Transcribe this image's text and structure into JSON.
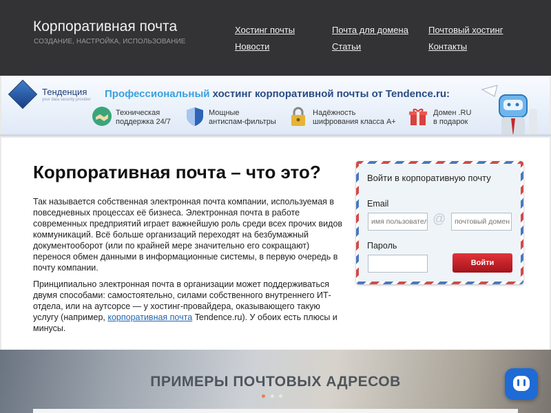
{
  "header": {
    "title": "Корпоративная почта",
    "subtitle": "СОЗДАНИЕ, НАСТРОЙКА, ИСПОЛЬЗОВАНИЕ",
    "nav": [
      "Хостинг почты",
      "Почта для домена",
      "Почтовый хостинг",
      "Новости",
      "Статьи",
      "Контакты"
    ]
  },
  "banner": {
    "logo_name": "Тенденция",
    "logo_tagline": "your data security provider",
    "headline_part1": "Профессиональный",
    "headline_part2": " хостинг корпоративной почты от Tendence.ru:",
    "features": [
      {
        "icon": "handshake-icon",
        "line1": "Техническая",
        "line2": "поддержка 24/7"
      },
      {
        "icon": "shield-icon",
        "line1": "Мощные",
        "line2": "антиспам-фильтры"
      },
      {
        "icon": "padlock-icon",
        "line1": "Надёжность",
        "line2": "шифрования класса A+"
      },
      {
        "icon": "gift-icon",
        "line1": "Домен .RU",
        "line2": "в подарок"
      }
    ]
  },
  "main": {
    "title": "Корпоративная почта – что это?",
    "para1": "Так называется собственная электронная почта компании, используемая в повседневных процессах её бизнеса. Электронная почта в работе современных предприятий играет важнейшую роль среди всех прочих видов коммуникаций. Всё больше организаций переходят на безбумажный документооборот (или по крайней мере значительно его сокращают) перенося обмен данными в информационные системы, в первую очередь в почту компании.",
    "para2_before": "Принципиально электронная почта в организации может поддерживаться двумя способами: самостоятельно, силами собственного внутреннего ИТ-отдела, или на аутсорсе — у хостинг-провайдера, оказывающего такую услугу (например, ",
    "para2_link": "корпоративная почта",
    "para2_after": " Tendence.ru). У обоих есть плюсы и минусы."
  },
  "login": {
    "title": "Войти в корпоративную почту",
    "email_label": "Email",
    "user_placeholder": "имя пользователя",
    "at_symbol": "@",
    "domain_placeholder": "почтовый домен",
    "password_label": "Пароль",
    "submit": "Войти"
  },
  "hero": {
    "title": "ПРИМЕРЫ ПОЧТОВЫХ АДРЕСОВ",
    "active_slide": 1,
    "slide_count": 3
  },
  "colors": {
    "header_bg": "#333234",
    "accent_red": "#c8252c",
    "link": "#2165b0",
    "chat": "#1e6bd6"
  }
}
